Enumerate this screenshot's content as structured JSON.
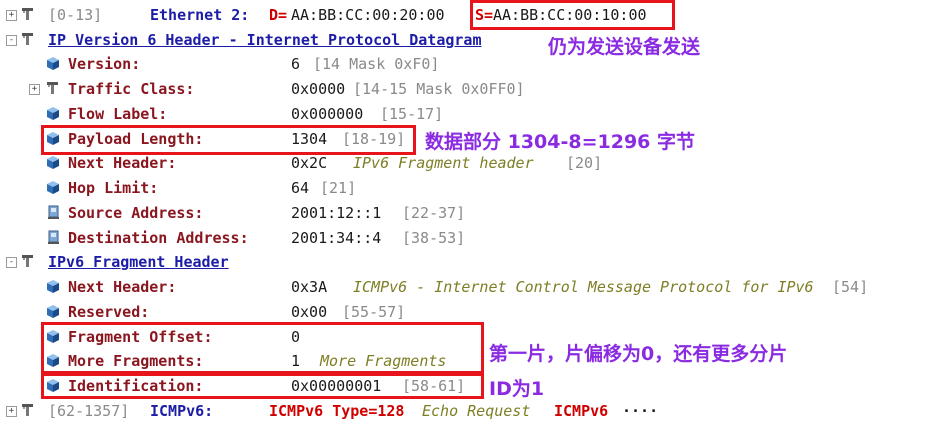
{
  "rows": [
    {
      "expander": "+",
      "icon": "filter",
      "range": "[0-13]",
      "name": "Ethernet 2:",
      "d_key": "D=",
      "d_val": "AA:BB:CC:00:20:00",
      "s_key": "S=",
      "s_val": "AA:BB:CC:00:10:00"
    },
    {
      "expander": "-",
      "icon": "filter",
      "name": "IP Version 6 Header - Internet Protocol Datagram"
    },
    {
      "icon": "cube",
      "name": "Version:",
      "value": "6",
      "extra": "[14 Mask 0xF0]"
    },
    {
      "expander": "+",
      "icon": "filter",
      "name": "Traffic Class:",
      "value": "0x0000",
      "extra": "[14-15 Mask 0x0FF0]"
    },
    {
      "icon": "cube",
      "name": "Flow Label:",
      "value": "0x000000",
      "extra": "[15-17]"
    },
    {
      "icon": "cube",
      "name": "Payload Length:",
      "value": "1304",
      "extra": "[18-19]"
    },
    {
      "icon": "cube",
      "name": "Next Header:",
      "value": "0x2C",
      "desc": "IPv6 Fragment header",
      "extra": "[20]"
    },
    {
      "icon": "cube",
      "name": "Hop Limit:",
      "value": "64",
      "extra": "[21]"
    },
    {
      "icon": "computer",
      "name": "Source Address:",
      "value": "2001:12::1",
      "extra": "[22-37]"
    },
    {
      "icon": "computer",
      "name": "Destination Address:",
      "value": "2001:34::4",
      "extra": "[38-53]"
    },
    {
      "expander": "-",
      "icon": "filter",
      "name": "IPv6 Fragment Header"
    },
    {
      "icon": "cube",
      "name": "Next Header:",
      "value": "0x3A",
      "desc": "ICMPv6 - Internet Control Message Protocol for IPv6",
      "extra": "[54]"
    },
    {
      "icon": "cube",
      "name": "Reserved:",
      "value": "0x00",
      "extra": "[55-57]"
    },
    {
      "icon": "cube",
      "name": "Fragment Offset:",
      "value": "0"
    },
    {
      "icon": "cube",
      "name": "More Fragments:",
      "value": "1",
      "desc": "More Fragments"
    },
    {
      "icon": "cube",
      "name": "Identification:",
      "value": "0x00000001",
      "extra": "[58-61]"
    },
    {
      "expander": "+",
      "icon": "filter",
      "range": "[62-1357]",
      "name": "ICMPv6:",
      "summary_red": "ICMPv6 Type=128",
      "summary_olive": "Echo Request",
      "summary_red2": "ICMPv6",
      "ellipsis": "····"
    }
  ],
  "annotations": {
    "mac": "仍为发送设备发送",
    "payload": "数据部分 1304-8=1296 字节",
    "fragment": "第一片，片偏移为0，还有更多分片",
    "id": "ID为1"
  },
  "colors": {
    "annotation": "#8a2be2",
    "highlight": "#e8141c",
    "field_name": "#8a1620",
    "header": "#1c1ca6",
    "desc": "#7e7e25"
  }
}
